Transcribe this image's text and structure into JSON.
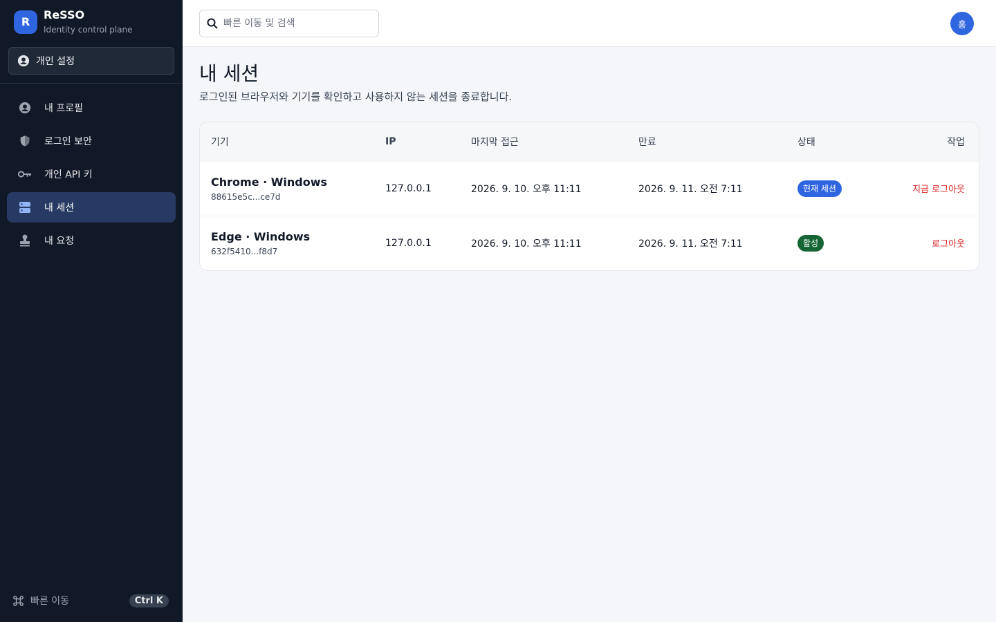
{
  "brand": {
    "logo": "R",
    "name": "ReSSO",
    "subtitle": "Identity control plane"
  },
  "scope": {
    "label": "개인 설정",
    "icon": "user-circle-icon"
  },
  "nav": [
    {
      "label": "내 프로필",
      "icon": "user-circle-icon",
      "active": false
    },
    {
      "label": "로그인 보안",
      "icon": "shield-icon",
      "active": false
    },
    {
      "label": "개인 API 키",
      "icon": "key-icon",
      "active": false
    },
    {
      "label": "내 세션",
      "icon": "server-icon",
      "active": true
    },
    {
      "label": "내 요청",
      "icon": "stamp-icon",
      "active": false
    }
  ],
  "quick": {
    "label": "빠른 이동",
    "shortcut": "Ctrl K",
    "icon": "command-icon"
  },
  "search": {
    "placeholder": "빠른 이동 및 검색",
    "icon": "search-icon"
  },
  "user": {
    "avatar": "홍"
  },
  "page": {
    "title": "내 세션",
    "description": "로그인된 브라우저와 기기를 확인하고 사용하지 않는 세션을 종료합니다."
  },
  "table": {
    "headers": {
      "device": "기기",
      "ip": "IP",
      "last_access": "마지막 접근",
      "expires": "만료",
      "status": "상태",
      "action": "작업"
    },
    "rows": [
      {
        "device": "Chrome · Windows",
        "id": "88615e5c...ce7d",
        "ip": "127.0.0.1",
        "last_access": "2026. 9. 10. 오후 11:11",
        "expires": "2026. 9. 11. 오전 7:11",
        "status": "현재 세션",
        "status_color": "#2f66e0",
        "action": "지금 로그아웃"
      },
      {
        "device": "Edge · Windows",
        "id": "632f5410...f8d7",
        "ip": "127.0.0.1",
        "last_access": "2026. 9. 10. 오후 11:11",
        "expires": "2026. 9. 11. 오전 7:11",
        "status": "활성",
        "status_color": "#166534",
        "action": "로그아웃"
      }
    ]
  },
  "colors": {
    "sidebar_bg": "#111827",
    "accent": "#2f66e0",
    "active_nav": "#263a63",
    "danger": "#dc2626",
    "success": "#166534"
  }
}
